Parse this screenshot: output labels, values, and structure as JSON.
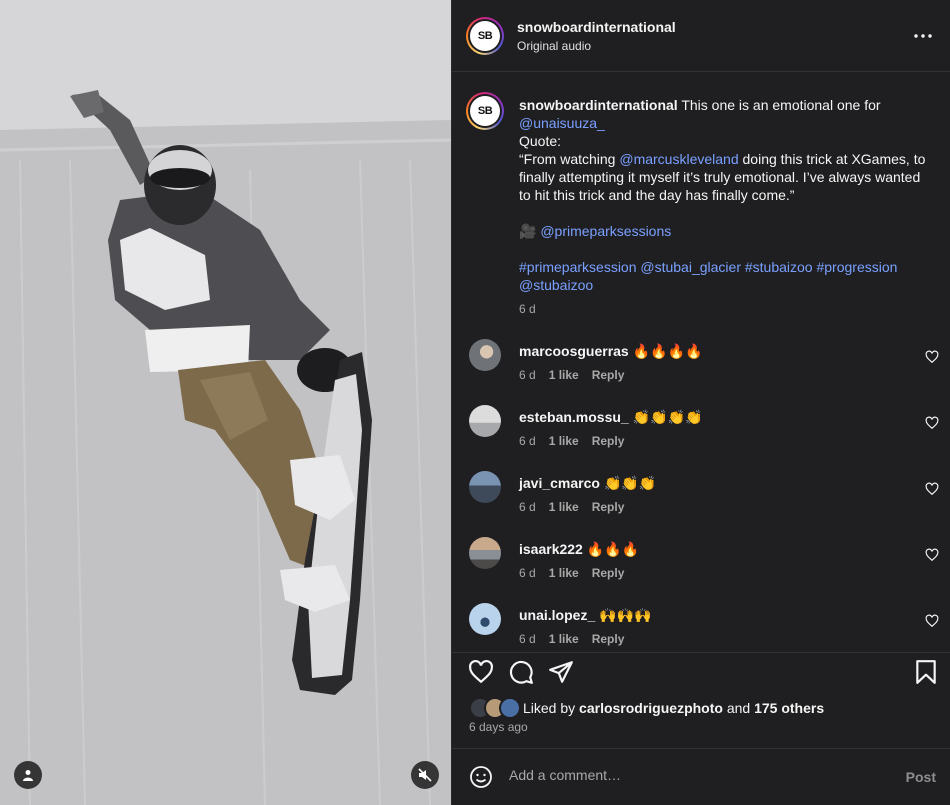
{
  "post": {
    "username": "snowboardinternational",
    "audio": "Original audio",
    "avatar_text": "SB"
  },
  "caption": {
    "username": "snowboardinternational",
    "intro": "This one is an emotional one for",
    "mention1": "@unaisuuza_",
    "quote_label": "Quote:",
    "quote_open": "“From watching",
    "mention2": "@marcuskleveland",
    "quote_rest": "doing this trick at XGames, to finally attempting it myself it’s truly emotional. I’ve always wanted to hit this trick and the day has finally come.”",
    "camera_emoji": "🎥",
    "mention3": "@primeparksessions",
    "hashtags": "#primeparksession @stubai_glacier #stubaizoo #progression @stubaizoo",
    "age": "6 d"
  },
  "comments": [
    {
      "user": "marcoosguerras",
      "text": "🔥🔥🔥🔥",
      "age": "6 d",
      "likes": "1 like",
      "reply": "Reply",
      "avatar_color": "#8a8f95"
    },
    {
      "user": "esteban.mossu_",
      "text": "👏👏👏👏",
      "age": "6 d",
      "likes": "1 like",
      "reply": "Reply",
      "avatar_color": "#b7b9bc"
    },
    {
      "user": "javi_cmarco",
      "text": "👏👏👏",
      "age": "6 d",
      "likes": "1 like",
      "reply": "Reply",
      "avatar_color": "#5c6f86"
    },
    {
      "user": "isaark222",
      "text": "🔥🔥🔥",
      "age": "6 d",
      "likes": "1 like",
      "reply": "Reply",
      "avatar_color": "#6d5f55"
    },
    {
      "user": "unai.lopez_",
      "text": "🙌🙌🙌",
      "age": "6 d",
      "likes": "1 like",
      "reply": "Reply",
      "avatar_color": "#8fb3d6"
    }
  ],
  "likes": {
    "prefix": "Liked by",
    "user": "carlosrodriguezphoto",
    "and": "and",
    "others": "175 others"
  },
  "date": "6 days ago",
  "composer": {
    "placeholder": "Add a comment…",
    "post_label": "Post"
  },
  "colors": {
    "panel_bg": "#1f1f21",
    "link": "#7aa0ff",
    "muted": "#a8a8a8"
  }
}
